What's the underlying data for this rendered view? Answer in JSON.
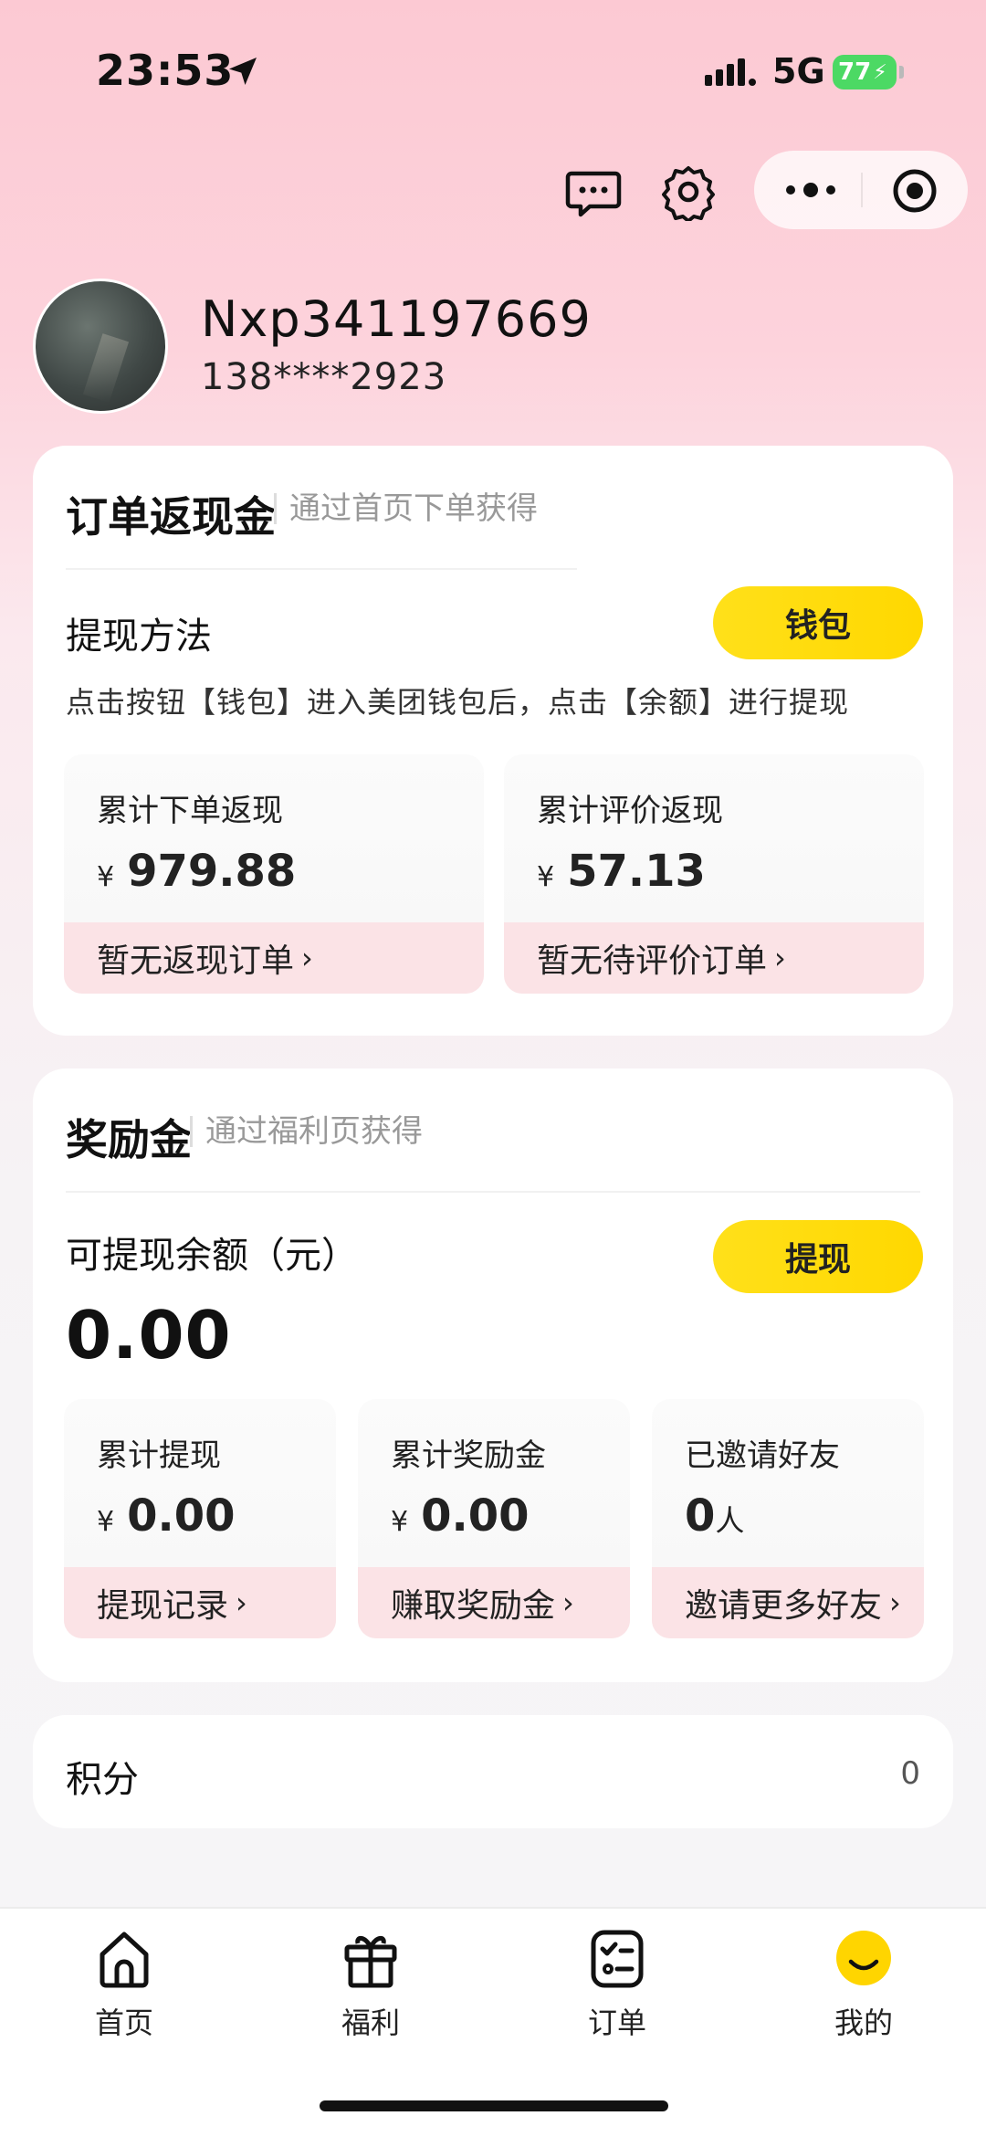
{
  "status_bar": {
    "time": "23:53",
    "network": "5G",
    "battery": "77"
  },
  "profile": {
    "username": "Nxp341197669",
    "phone": "138****2923"
  },
  "order_cashback": {
    "title": "订单返现金",
    "subtitle": "通过首页下单获得",
    "method_label": "提现方法",
    "wallet_button": "钱包",
    "description": "点击按钮【钱包】进入美团钱包后，点击【余额】进行提现",
    "stats": [
      {
        "label": "累计下单返现",
        "currency": "¥",
        "value": "979.88",
        "link": "暂无返现订单"
      },
      {
        "label": "累计评价返现",
        "currency": "¥",
        "value": "57.13",
        "link": "暂无待评价订单"
      }
    ]
  },
  "reward": {
    "title": "奖励金",
    "subtitle": "通过福利页获得",
    "balance_label": "可提现余额（元）",
    "balance": "0.00",
    "withdraw_button": "提现",
    "stats": [
      {
        "label": "累计提现",
        "currency": "¥",
        "value": "0.00",
        "link": "提现记录"
      },
      {
        "label": "累计奖励金",
        "currency": "¥",
        "value": "0.00",
        "link": "赚取奖励金"
      },
      {
        "label": "已邀请好友",
        "value": "0",
        "unit": "人",
        "link": "邀请更多好友"
      }
    ]
  },
  "points": {
    "label": "积分",
    "value": "0"
  },
  "nav": [
    {
      "label": "首页",
      "icon": "home-icon"
    },
    {
      "label": "福利",
      "icon": "gift-icon"
    },
    {
      "label": "订单",
      "icon": "order-list-icon"
    },
    {
      "label": "我的",
      "icon": "smiley-icon"
    }
  ],
  "colors": {
    "accent_yellow": "#FFDD00",
    "link_bg": "#FBE3E6",
    "battery_green": "#4CD964"
  }
}
